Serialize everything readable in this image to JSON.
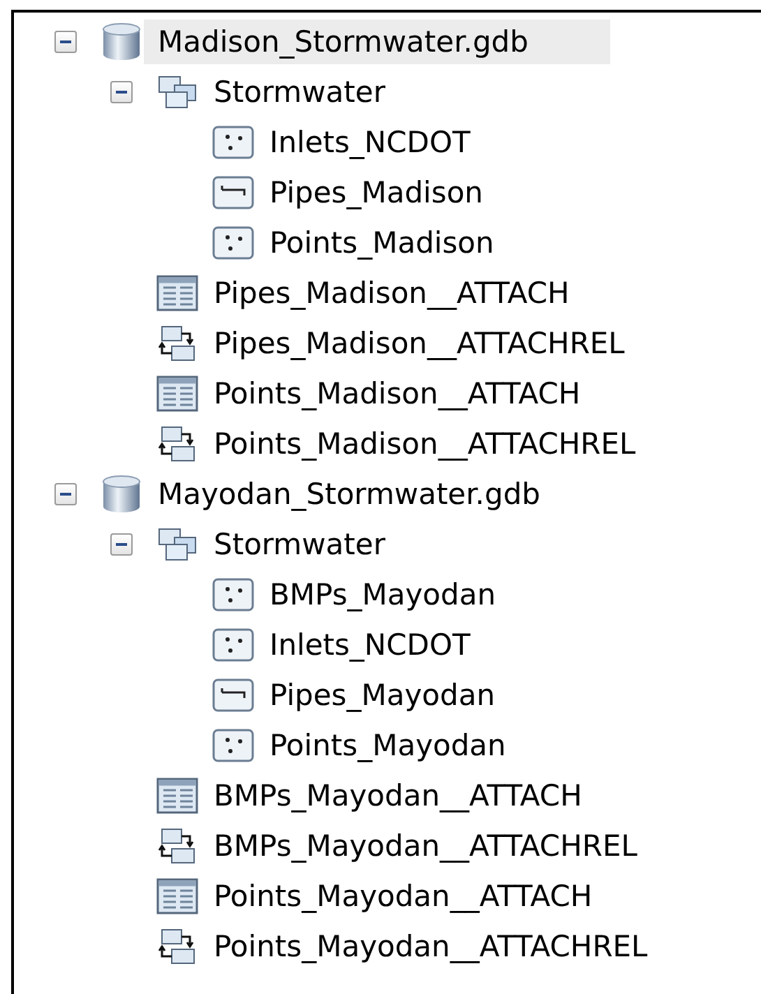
{
  "tree": [
    {
      "label": "Madison_Stormwater.gdb",
      "kind": "database",
      "expanded": true,
      "selected": true,
      "children": [
        {
          "label": "Stormwater",
          "kind": "dataset",
          "expanded": true,
          "selected": false,
          "children": [
            {
              "label": "Inlets_NCDOT",
              "kind": "points",
              "selected": false
            },
            {
              "label": "Pipes_Madison",
              "kind": "lines",
              "selected": false
            },
            {
              "label": "Points_Madison",
              "kind": "points",
              "selected": false
            }
          ]
        },
        {
          "label": "Pipes_Madison__ATTACH",
          "kind": "table",
          "selected": false
        },
        {
          "label": "Pipes_Madison__ATTACHREL",
          "kind": "relationship",
          "selected": false
        },
        {
          "label": "Points_Madison__ATTACH",
          "kind": "table",
          "selected": false
        },
        {
          "label": "Points_Madison__ATTACHREL",
          "kind": "relationship",
          "selected": false
        }
      ]
    },
    {
      "label": "Mayodan_Stormwater.gdb",
      "kind": "database",
      "expanded": true,
      "selected": false,
      "children": [
        {
          "label": "Stormwater",
          "kind": "dataset",
          "expanded": true,
          "selected": false,
          "children": [
            {
              "label": "BMPs_Mayodan",
              "kind": "points",
              "selected": false
            },
            {
              "label": "Inlets_NCDOT",
              "kind": "points",
              "selected": false
            },
            {
              "label": "Pipes_Mayodan",
              "kind": "lines",
              "selected": false
            },
            {
              "label": "Points_Mayodan",
              "kind": "points",
              "selected": false
            }
          ]
        },
        {
          "label": "BMPs_Mayodan__ATTACH",
          "kind": "table",
          "selected": false
        },
        {
          "label": "BMPs_Mayodan__ATTACHREL",
          "kind": "relationship",
          "selected": false
        },
        {
          "label": "Points_Mayodan__ATTACH",
          "kind": "table",
          "selected": false
        },
        {
          "label": "Points_Mayodan__ATTACHREL",
          "kind": "relationship",
          "selected": false
        }
      ]
    }
  ]
}
